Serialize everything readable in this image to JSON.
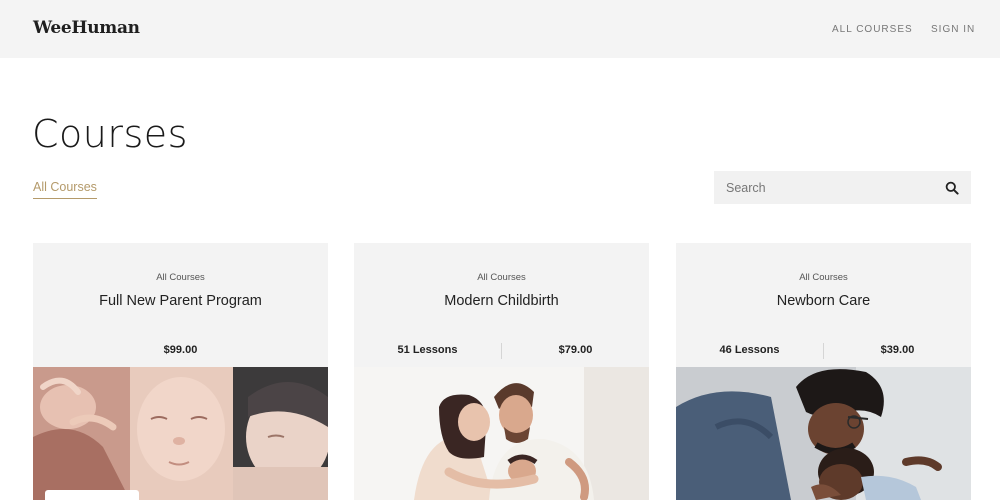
{
  "header": {
    "logo": "WeeHuman",
    "nav": {
      "all_courses": "ALL COURSES",
      "sign_in": "SIGN IN"
    }
  },
  "main": {
    "title": "Courses",
    "filter_tab": "All Courses",
    "search": {
      "placeholder": "Search",
      "value": ""
    }
  },
  "courses": [
    {
      "category": "All Courses",
      "title": "Full New Parent Program",
      "lessons": "",
      "price": "$99.00"
    },
    {
      "category": "All Courses",
      "title": "Modern Childbirth",
      "lessons": "51 Lessons",
      "price": "$79.00"
    },
    {
      "category": "All Courses",
      "title": "Newborn Care",
      "lessons": "46 Lessons",
      "price": "$39.00"
    }
  ],
  "colors": {
    "accent": "#b49a6a",
    "header_bg": "#f4f4f4",
    "card_bg": "#f3f3f3"
  }
}
